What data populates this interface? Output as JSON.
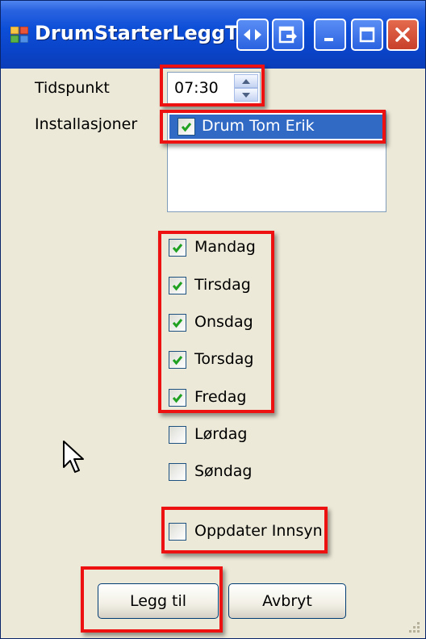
{
  "window": {
    "title": "DrumStarterLeggTil",
    "accent": "#0a44c9",
    "close_color": "#c8402a"
  },
  "titlebar_buttons": [
    "arrows-icon",
    "exit-icon",
    "minimize-icon",
    "maximize-icon",
    "close-icon"
  ],
  "form": {
    "time_label": "Tidspunkt",
    "time_value": "07:30",
    "installations_label": "Installasjoner",
    "installations": [
      {
        "label": "Drum Tom Erik",
        "checked": true,
        "selected": true
      }
    ]
  },
  "days": [
    {
      "label": "Mandag",
      "checked": true
    },
    {
      "label": "Tirsdag",
      "checked": true
    },
    {
      "label": "Onsdag",
      "checked": true
    },
    {
      "label": "Torsdag",
      "checked": true
    },
    {
      "label": "Fredag",
      "checked": true
    },
    {
      "label": "Lørdag",
      "checked": false
    },
    {
      "label": "Søndag",
      "checked": false
    }
  ],
  "update": {
    "label": "Oppdater Innsyn",
    "checked": false
  },
  "buttons": {
    "add_label": "Legg til",
    "cancel_label": "Avbryt"
  },
  "annotation_color": "#ee1111"
}
